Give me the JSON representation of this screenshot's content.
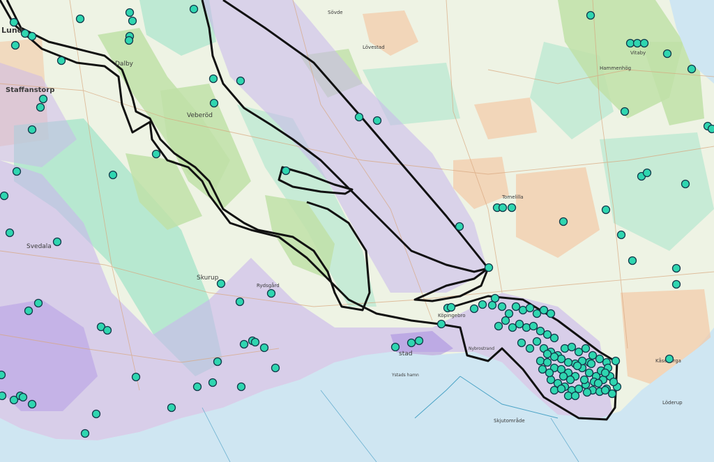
{
  "map": {
    "labels": {
      "lund": "Lund",
      "staffanstorp": "Staffanstorp",
      "dalby": "Dalby",
      "veberod": "Veberöd",
      "skurup": "Skurup",
      "svedala": "Svedala",
      "rydsgard": "Rydsgård",
      "ystad": "stad",
      "ystad_sea": "Ystads hamn",
      "skjutomrade": "Skjutområde",
      "vitaby": "Vitaby",
      "hammenhog": "Hammenhög",
      "simrishamn_area": "Tomelilla",
      "lovestad": "Lövestad",
      "sjobo_area": "Sövde",
      "kopingebro": "Köpingebro",
      "nybrostrand": "Nybrostrand",
      "kaseberga": "Kåseberga",
      "loderup": "Löderup"
    },
    "colors": {
      "sea": "#cfe6f2",
      "land": "#eef3e4",
      "purple_zone": "#c9b6ec",
      "teal_zone": "#9fe3c8",
      "orange_zone": "#f3c9a6",
      "forest": "#bfe0a8",
      "point_fill": "#2fd6b0",
      "boundary": "#111111"
    }
  }
}
